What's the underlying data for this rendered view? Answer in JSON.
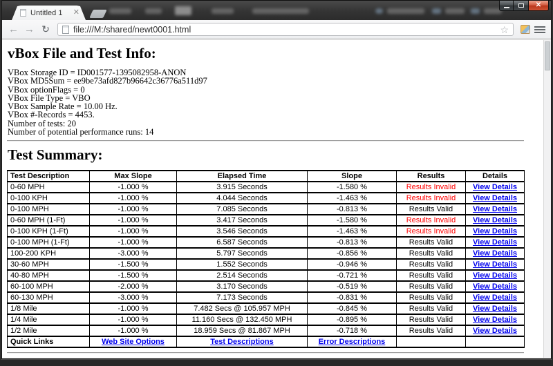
{
  "browser": {
    "tab_title": "Untitled 1",
    "url": "file:///M:/shared/newt0001.html"
  },
  "page": {
    "info_heading": "vBox File and Test Info:",
    "info_lines": [
      "VBox Storage ID = ID001577-1395082958-ANON",
      "VBox MD5Sum = ee9be73afd827b96642c36776a511d97",
      "VBox optionFlags = 0",
      "VBox File Type = VBO",
      "VBox Sample Rate = 10.00 Hz.",
      "VBox #-Records = 4453.",
      "Number of tests: 20",
      "Number of potential performance runs: 14"
    ],
    "summary_heading": "Test Summary:",
    "table": {
      "headers": [
        "Test Description",
        "Max Slope",
        "Elapsed Time",
        "Slope",
        "Results",
        "Details"
      ],
      "rows": [
        [
          "0-60 MPH",
          "-1.000 %",
          "3.915 Seconds",
          "-1.580 %",
          "Results Invalid",
          "View Details"
        ],
        [
          "0-100 KPH",
          "-1.000 %",
          "4.044 Seconds",
          "-1.463 %",
          "Results Invalid",
          "View Details"
        ],
        [
          "0-100 MPH",
          "-1.000 %",
          "7.085 Seconds",
          "-0.813 %",
          "Results Valid",
          "View Details"
        ],
        [
          "0-60 MPH (1-Ft)",
          "-1.000 %",
          "3.417 Seconds",
          "-1.580 %",
          "Results Invalid",
          "View Details"
        ],
        [
          "0-100 KPH (1-Ft)",
          "-1.000 %",
          "3.546 Seconds",
          "-1.463 %",
          "Results Invalid",
          "View Details"
        ],
        [
          "0-100 MPH (1-Ft)",
          "-1.000 %",
          "6.587 Seconds",
          "-0.813 %",
          "Results Valid",
          "View Details"
        ],
        [
          "100-200 KPH",
          "-3.000 %",
          "5.797 Seconds",
          "-0.856 %",
          "Results Valid",
          "View Details"
        ],
        [
          "30-60 MPH",
          "-1.500 %",
          "1.552 Seconds",
          "-0.946 %",
          "Results Valid",
          "View Details"
        ],
        [
          "40-80 MPH",
          "-1.500 %",
          "2.514 Seconds",
          "-0.721 %",
          "Results Valid",
          "View Details"
        ],
        [
          "60-100 MPH",
          "-2.000 %",
          "3.170 Seconds",
          "-0.519 %",
          "Results Valid",
          "View Details"
        ],
        [
          "60-130 MPH",
          "-3.000 %",
          "7.173 Seconds",
          "-0.831 %",
          "Results Valid",
          "View Details"
        ],
        [
          "1/8 Mile",
          "-1.000 %",
          "7.482 Secs @ 105.957 MPH",
          "-0.845 %",
          "Results Valid",
          "View Details"
        ],
        [
          "1/4 Mile",
          "-1.000 %",
          "11.160 Secs @ 132.450 MPH",
          "-0.895 %",
          "Results Valid",
          "View Details"
        ],
        [
          "1/2 Mile",
          "-1.000 %",
          "18.959 Secs @ 81.867 MPH",
          "-0.718 %",
          "Results Valid",
          "View Details"
        ]
      ],
      "invalid_text": "Results Invalid",
      "quick_links": {
        "label": "Quick Links",
        "links": [
          "Web Site Options",
          "Test Descriptions",
          "Error Descriptions"
        ]
      }
    },
    "colors": {
      "link_blue": "#0000EE",
      "invalid_red": "#FF0000"
    }
  }
}
